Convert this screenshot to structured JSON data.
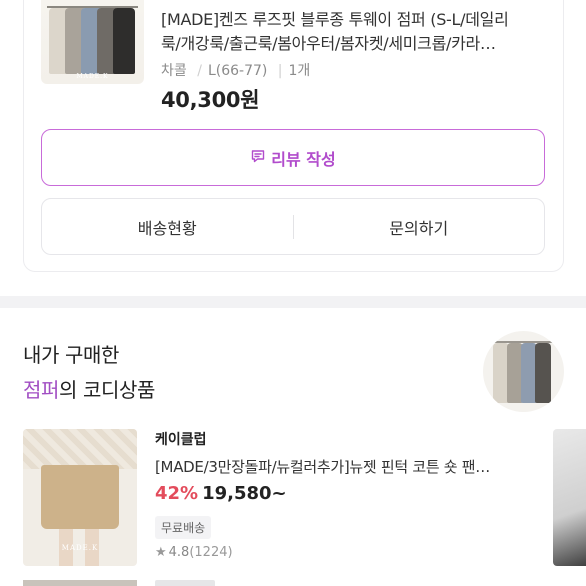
{
  "order": {
    "product_title_line1": "[MADE]켄즈 루즈핏 블루종 투웨이 점퍼 (S-L/데일리",
    "product_title_line2": "룩/개강룩/출근룩/봄아우터/봄자켓/세미크롭/카라…",
    "option_color": "차콜",
    "option_size": "L(66-77)",
    "option_qty": "1개",
    "price": "40,300원",
    "thumb_tag": "MADE.K",
    "review_button_label": "리뷰 작성",
    "review_icon": "message-square-icon",
    "accent_color": "#b14ccc",
    "actions": [
      {
        "label": "배송현황"
      },
      {
        "label": "문의하기"
      }
    ]
  },
  "recommend": {
    "heading_line1": "내가 구매한",
    "heading_accent": "점퍼",
    "heading_rest": "의 코디상품",
    "accent_color": "#a14ec3"
  },
  "item": {
    "brand": "케이클럽",
    "name": "[MADE/3만장돌파/뉴컬러추가]뉴젯 핀턱 코튼 숏 팬…",
    "discount": "42%",
    "price": "19,580~",
    "badge": "무료배송",
    "rating": "4.8",
    "review_count": "(1224)",
    "image_tag": "MADE.K",
    "discount_color": "#e34c5c"
  }
}
